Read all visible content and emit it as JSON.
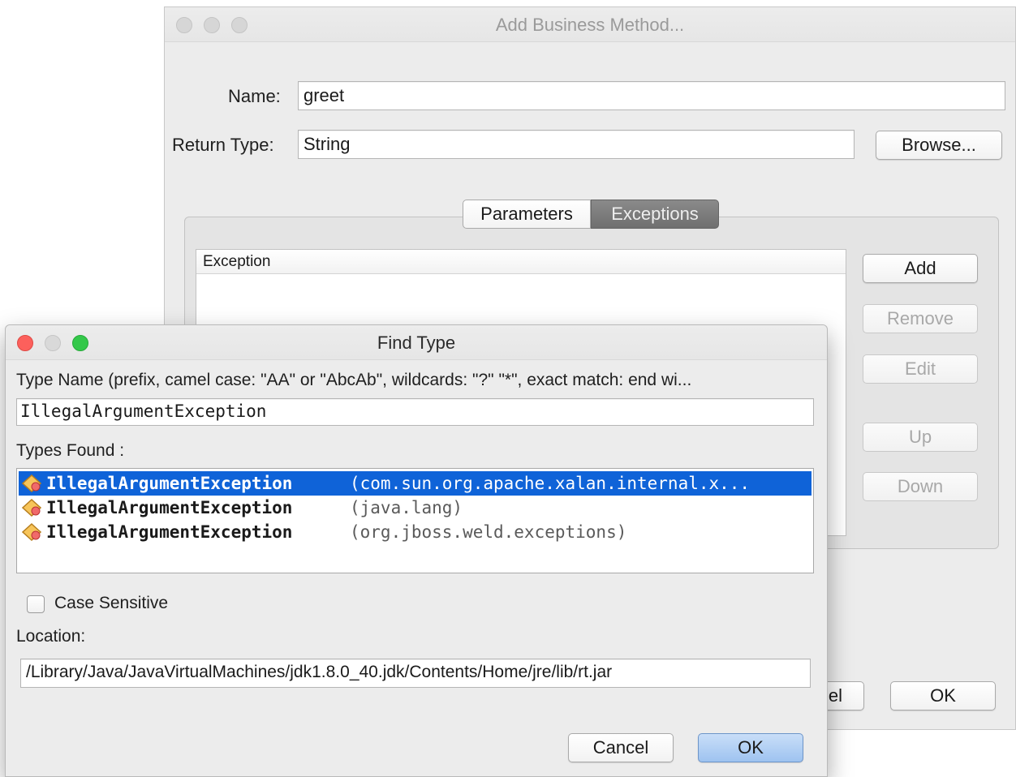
{
  "background_dialog": {
    "title": "Add Business Method...",
    "name_label": "Name:",
    "name_value": "greet",
    "return_type_label": "Return Type:",
    "return_type_value": "String",
    "browse_button": "Browse...",
    "tabs": [
      {
        "label": "Parameters",
        "active": false
      },
      {
        "label": "Exceptions",
        "active": true
      }
    ],
    "table_header": "Exception",
    "side_buttons": [
      {
        "label": "Add",
        "enabled": true
      },
      {
        "label": "Remove",
        "enabled": false
      },
      {
        "label": "Edit",
        "enabled": false
      },
      {
        "label": "Up",
        "enabled": false
      },
      {
        "label": "Down",
        "enabled": false
      }
    ],
    "cancel_visible_fragment": "el",
    "ok_button": "OK"
  },
  "find_type_dialog": {
    "title": "Find Type",
    "type_name_label": "Type Name (prefix, camel case: \"AA\" or \"AbcAb\", wildcards: \"?\" \"*\", exact match: end wi...",
    "type_name_value": "IllegalArgumentException",
    "types_found_label": "Types Found :",
    "results": [
      {
        "name": "IllegalArgumentException",
        "package": "(com.sun.org.apache.xalan.internal.x...",
        "selected": true
      },
      {
        "name": "IllegalArgumentException",
        "package": "(java.lang)",
        "selected": false
      },
      {
        "name": "IllegalArgumentException",
        "package": "(org.jboss.weld.exceptions)",
        "selected": false
      }
    ],
    "case_sensitive_label": "Case Sensitive",
    "case_sensitive_checked": false,
    "location_label": "Location:",
    "location_value": "/Library/Java/JavaVirtualMachines/jdk1.8.0_40.jdk/Contents/Home/jre/lib/rt.jar",
    "cancel_button": "Cancel",
    "ok_button": "OK"
  },
  "colors": {
    "selection": "#0f63d8",
    "close": "#fc605c",
    "zoom": "#34c84a",
    "primary_button": "#9ec3f0"
  }
}
